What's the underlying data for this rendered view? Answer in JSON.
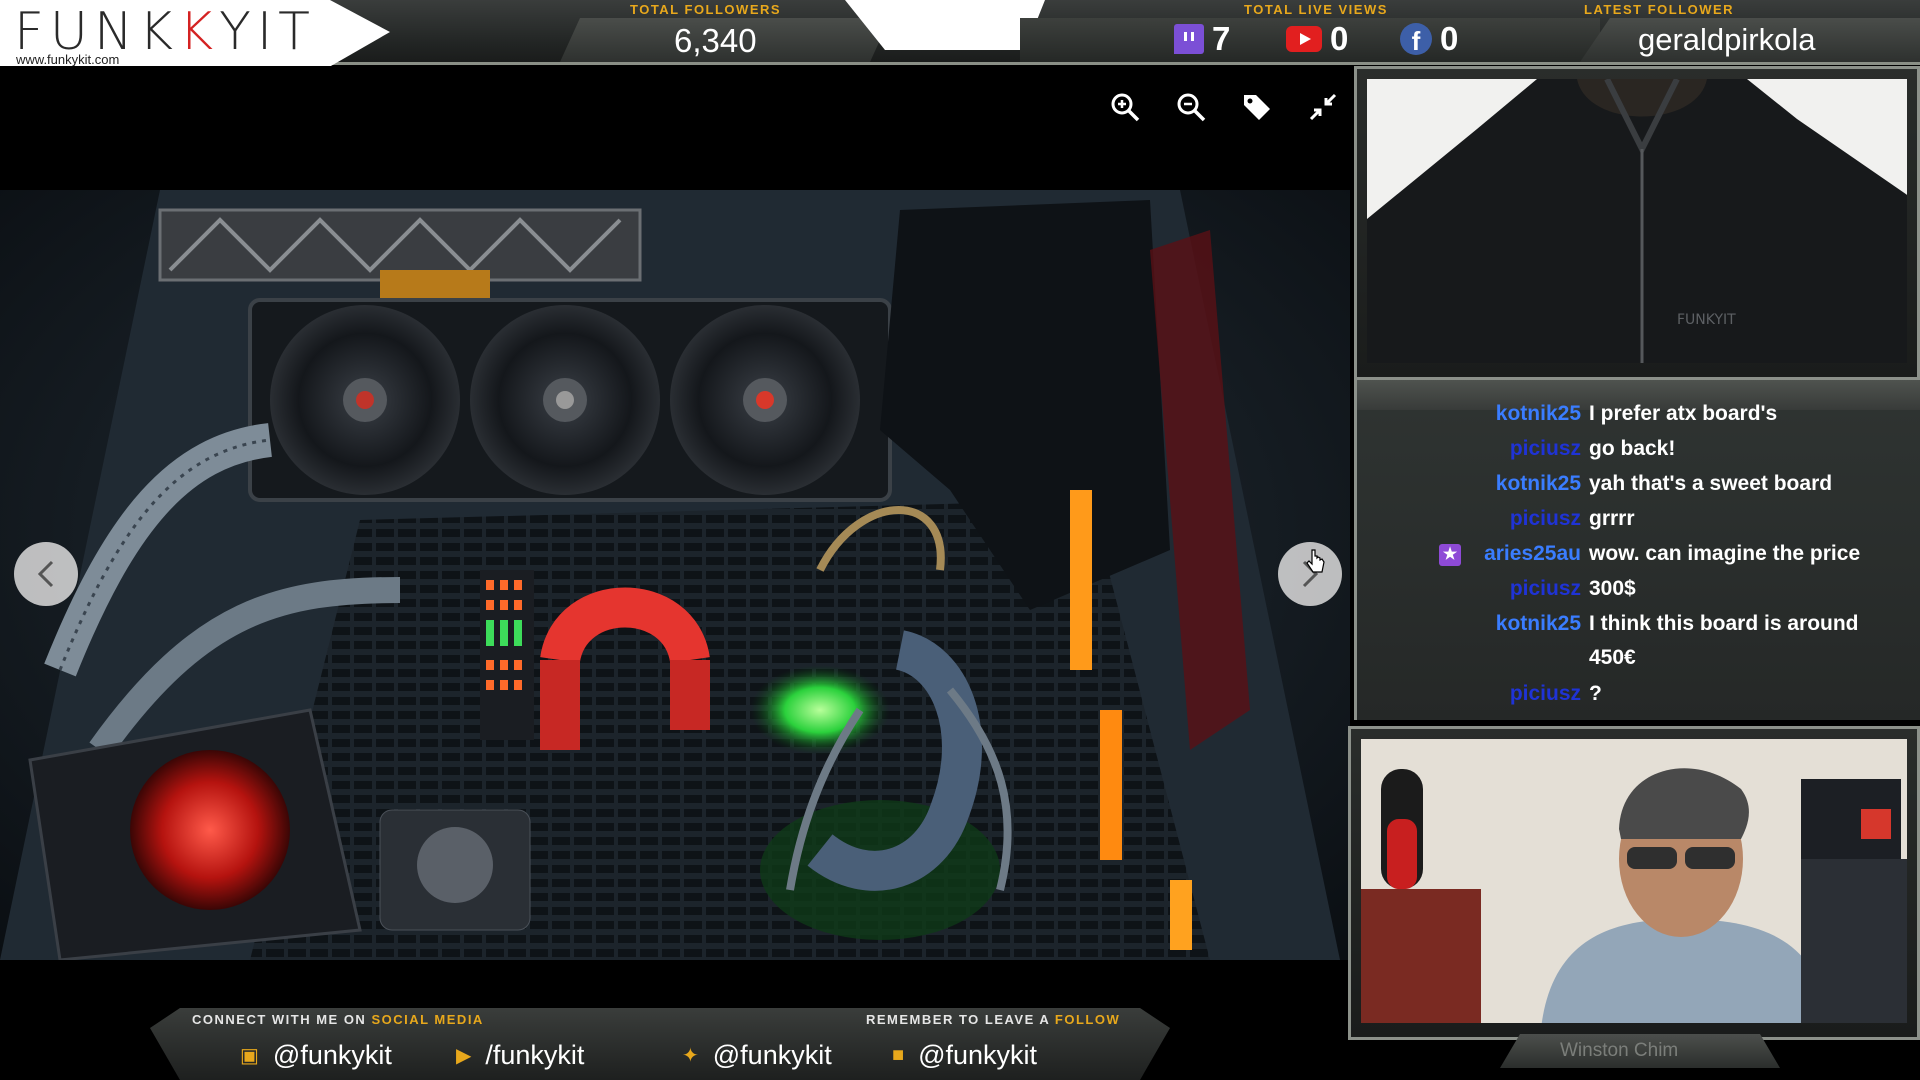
{
  "brand": {
    "logo_pre": "FUNK",
    "logo_post": "YIT",
    "url": "www.funkykit.com"
  },
  "stats": {
    "total_followers_label": "TOTAL FOLLOWERS",
    "total_followers_value": "6,340",
    "total_live_views_label": "TOTAL LIVE VIEWS",
    "twitch_count": "7",
    "youtube_count": "0",
    "facebook_count": "0",
    "latest_follower_label": "LATEST FOLLOWER",
    "latest_follower_value": "geraldpirkola"
  },
  "viewer": {
    "tools": [
      "zoom-in-icon",
      "zoom-out-icon",
      "tag-icon",
      "collapse-icon"
    ]
  },
  "chat": {
    "messages": [
      {
        "user": "kotnik25",
        "text": "I prefer atx board's",
        "color": "#3a7dff"
      },
      {
        "user": "piciusz",
        "text": "go back!",
        "color": "#1f33d6"
      },
      {
        "user": "kotnik25",
        "text": "yah that's a sweet board",
        "color": "#3a7dff"
      },
      {
        "user": "piciusz",
        "text": "grrrr",
        "color": "#1f33d6"
      },
      {
        "user": "aries25au",
        "text": "wow. can imagine the price",
        "color": "#3a7dff"
      },
      {
        "user": "piciusz",
        "text": "300$",
        "color": "#1f33d6"
      },
      {
        "user": "kotnik25",
        "text": "I think this board is around",
        "color": "#3a7dff"
      },
      {
        "user": "",
        "text": "450€",
        "color": "#3a7dff"
      },
      {
        "user": "piciusz",
        "text": "?",
        "color": "#1f33d6"
      }
    ]
  },
  "cam": {
    "name": "Winston Chim"
  },
  "footer": {
    "connect_pre": "CONNECT WITH ME ON ",
    "connect_hl": "SOCIAL MEDIA",
    "remember_pre": "REMEMBER TO LEAVE A ",
    "remember_hl": "FOLLOW",
    "socials": [
      {
        "icon": "twitch-icon",
        "handle": "@funkykit"
      },
      {
        "icon": "youtube-icon",
        "handle": "/funkykit"
      },
      {
        "icon": "twitter-icon",
        "handle": "@funkykit"
      },
      {
        "icon": "facebook-icon",
        "handle": "@funkykit"
      }
    ]
  },
  "colors": {
    "accent": "#e8a81c",
    "brand_red": "#d42222"
  }
}
